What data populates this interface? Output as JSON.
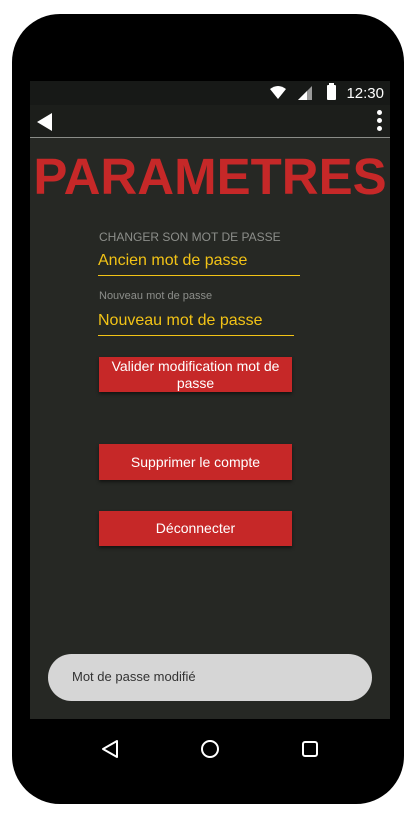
{
  "status_bar": {
    "time": "12:30",
    "icons": [
      "wifi-icon",
      "signal-icon",
      "battery-icon"
    ]
  },
  "app_bar": {
    "back_icon": "back-arrow-icon",
    "menu_icon": "overflow-menu-icon"
  },
  "page": {
    "title": "PARAMETRES"
  },
  "password_section": {
    "label": "CHANGER SON MOT DE PASSE",
    "old_password_placeholder": "Ancien mot de passe",
    "new_password_label": "Nouveau mot de passe",
    "new_password_placeholder": "Nouveau mot de passe",
    "validate_label": "Valider modification mot de passe"
  },
  "account_actions": {
    "delete_label": "Supprimer le compte",
    "logout_label": "Déconnecter"
  },
  "toast": {
    "message": "Mot de passe modifié"
  },
  "nav_bar": {
    "icons": [
      "nav-back-icon",
      "nav-home-icon",
      "nav-recents-icon"
    ]
  },
  "colors": {
    "accent_red": "#c62828",
    "field_yellow": "#f2c316",
    "screen_background": "#262824"
  }
}
